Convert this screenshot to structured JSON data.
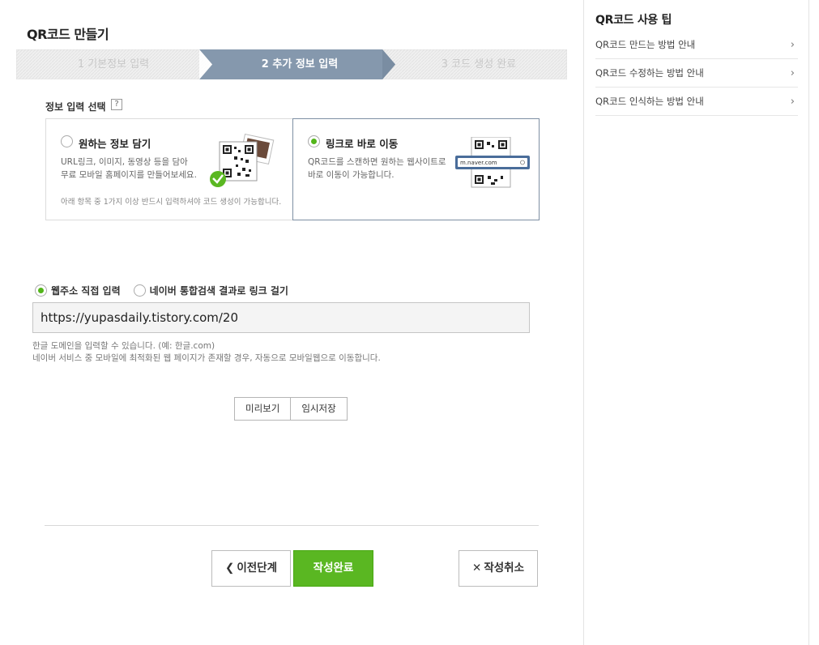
{
  "page": {
    "title": "QR코드 만들기"
  },
  "steps": [
    {
      "label": "1 기본정보 입력"
    },
    {
      "label": "2 추가 정보 입력"
    },
    {
      "label": "3 코드 생성 완료"
    }
  ],
  "info_select": {
    "label": "정보 입력 선택",
    "help": "?"
  },
  "option_1": {
    "title": "원하는 정보 담기",
    "desc_1": "URL링크, 이미지, 동영상 등을 담아",
    "desc_2": "무료 모바일 홈페이지를 만들어보세요.",
    "note": "아래 항목 중 1가지 이상 반드시 입력하셔야 코드 생성이 가능합니다."
  },
  "option_2": {
    "title": "링크로 바로 이동",
    "desc_1": "QR코드를 스캔하면 원하는 웹사이트로",
    "desc_2": "바로 이동이 가능합니다.",
    "url_sample": "m.naver.com"
  },
  "link_type": {
    "direct_label": "웹주소 직접 입력",
    "naver_label": "네이버 통합검색 결과로 링크 걸기"
  },
  "url_field": {
    "value": "https://yupasdaily.tistory.com/20"
  },
  "hints": {
    "line_1": "한글 도메인을 입력할 수 있습니다. (예: 한글.com)",
    "line_2": "네이버 서비스 중 모바일에 최적화된 웹 페이지가 존재할 경우, 자동으로 모바일웹으로 이동합니다."
  },
  "small_buttons": {
    "preview": "미리보기",
    "temp_save": "임시저장"
  },
  "actions": {
    "prev": "이전단계",
    "done": "작성완료",
    "cancel": "작성취소"
  },
  "tips": {
    "title": "QR코드 사용 팁",
    "items": [
      {
        "label": "QR코드 만드는 방법 안내"
      },
      {
        "label": "QR코드 수정하는 방법 안내"
      },
      {
        "label": "QR코드 인식하는 방법 안내"
      }
    ]
  },
  "colors": {
    "accent_green": "#5ab722",
    "step_active": "#8598ad"
  }
}
